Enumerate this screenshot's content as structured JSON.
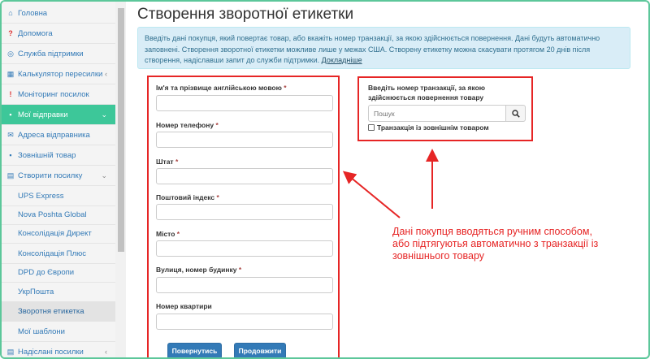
{
  "sidebar": {
    "items": [
      {
        "label": "Головна",
        "icon": "home-icon",
        "glyph": "⌂"
      },
      {
        "label": "Допомога",
        "icon": "help-icon",
        "glyph": "?"
      },
      {
        "label": "Служба підтримки",
        "icon": "support-icon",
        "glyph": "◎"
      },
      {
        "label": "Калькулятор пересилки",
        "icon": "calculator-icon",
        "glyph": "▦"
      },
      {
        "label": "Моніторинг посилок",
        "icon": "alert-icon",
        "glyph": "!"
      },
      {
        "label": "Мої відправки",
        "icon": "truck-icon",
        "glyph": "▪"
      },
      {
        "label": "Адреса відправника",
        "icon": "envelope-icon",
        "glyph": "✉"
      },
      {
        "label": "Зовнішній товар",
        "icon": "box-icon",
        "glyph": "▪"
      },
      {
        "label": "Створити посилку",
        "icon": "package-icon",
        "glyph": "▤"
      },
      {
        "label": "UPS Express"
      },
      {
        "label": "Nova Poshta Global"
      },
      {
        "label": "Консолідація Директ"
      },
      {
        "label": "Консолідація Плюс"
      },
      {
        "label": "DPD до Європи"
      },
      {
        "label": "УкрПошта"
      },
      {
        "label": "Зворотня етикетка"
      },
      {
        "label": "Мої шаблони"
      },
      {
        "label": "Надіслані посилки",
        "icon": "sent-icon",
        "glyph": "▤"
      }
    ],
    "chevron_down": "⌄",
    "chevron_left": "‹"
  },
  "page": {
    "title": "Створення зворотної етикетки",
    "info_text": "Введіть дані покупця, який повертає товар, або вкажіть номер транзакції, за якою здійснюється повернення. Дані будуть автоматично заповнені. Створення зворотної етикетки можливе лише у межах США. Створену етикетку можна скасувати протягом 20 днів після створення, надіславши запит до служби підтримки.",
    "info_link": "Докладніше"
  },
  "form": {
    "required_mark": "*",
    "fields": [
      {
        "label": "Ім'я та прізвище англійською мовою",
        "required": true
      },
      {
        "label": "Номер телефону",
        "required": true
      },
      {
        "label": "Штат",
        "required": true
      },
      {
        "label": "Поштовий індекс",
        "required": true
      },
      {
        "label": "Місто",
        "required": true
      },
      {
        "label": "Вулиця, номер будинку",
        "required": true
      },
      {
        "label": "Номер квартири",
        "required": false
      }
    ],
    "back_label": "Повернутись",
    "continue_label": "Продовжити"
  },
  "transaction": {
    "label": "Введіть номер транзакції, за якою здійснюється повернення товару",
    "search_placeholder": "Пошук",
    "checkbox_label": "Транзакція із зовнішнім товаром"
  },
  "annotation": {
    "text": "Дані покупця вводяться ручним способом, або підтягуютья автоматично з транзакції із зовнішнього товару"
  },
  "colors": {
    "accent": "#3dc799",
    "primary": "#337ab7",
    "annotation": "#e62525",
    "info_bg": "#d9edf7"
  }
}
